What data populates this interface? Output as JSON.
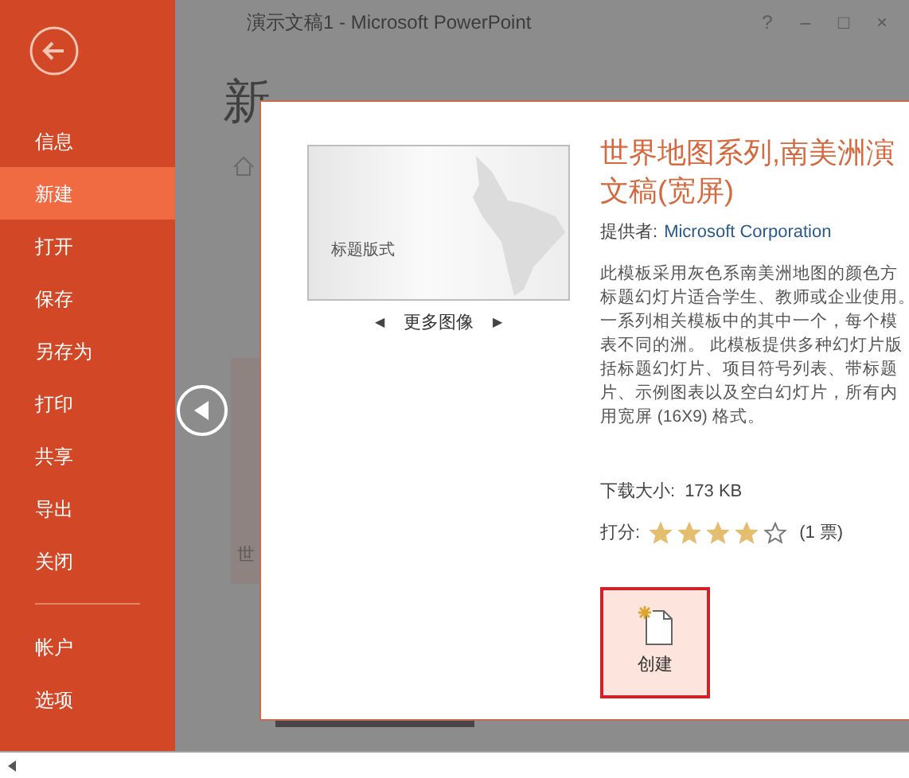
{
  "window": {
    "title": "演示文稿1 - Microsoft PowerPoint",
    "controls": [
      "?",
      "–",
      "□",
      "×"
    ]
  },
  "sidebar": {
    "items": [
      {
        "label": "信息",
        "selected": false
      },
      {
        "label": "新建",
        "selected": true
      },
      {
        "label": "打开",
        "selected": false
      },
      {
        "label": "保存",
        "selected": false
      },
      {
        "label": "另存为",
        "selected": false
      },
      {
        "label": "打印",
        "selected": false
      },
      {
        "label": "共享",
        "selected": false
      },
      {
        "label": "导出",
        "selected": false
      },
      {
        "label": "关闭",
        "selected": false
      }
    ],
    "footer_items": [
      {
        "label": "帐户",
        "selected": false
      },
      {
        "label": "选项",
        "selected": false
      }
    ]
  },
  "page": {
    "heading": "新",
    "tile_caption": "世"
  },
  "dialog": {
    "preview": {
      "slide_title": "标题版式",
      "more_images": "更多图像",
      "prev": "◀",
      "next": "▶"
    },
    "title_lines": [
      "世界地图系列,南美洲演",
      "文稿(宽屏)"
    ],
    "provider_label": "提供者:",
    "provider": "Microsoft Corporation",
    "description_lines": [
      "此模板采用灰色系南美洲地图的颜色方",
      "标题幻灯片适合学生、教师或企业使用。",
      "一系列相关模板中的其中一个，每个模",
      "表不同的洲。 此模板提供多种幻灯片版",
      "括标题幻灯片、项目符号列表、带标题",
      "片、示例图表以及空白幻灯片，所有内",
      "用宽屏 (16X9) 格式。"
    ],
    "size_label": "下载大小:",
    "size": "173 KB",
    "rating_label": "打分:",
    "stars": 4,
    "votes": "(1 票)",
    "create_button": "创建"
  }
}
